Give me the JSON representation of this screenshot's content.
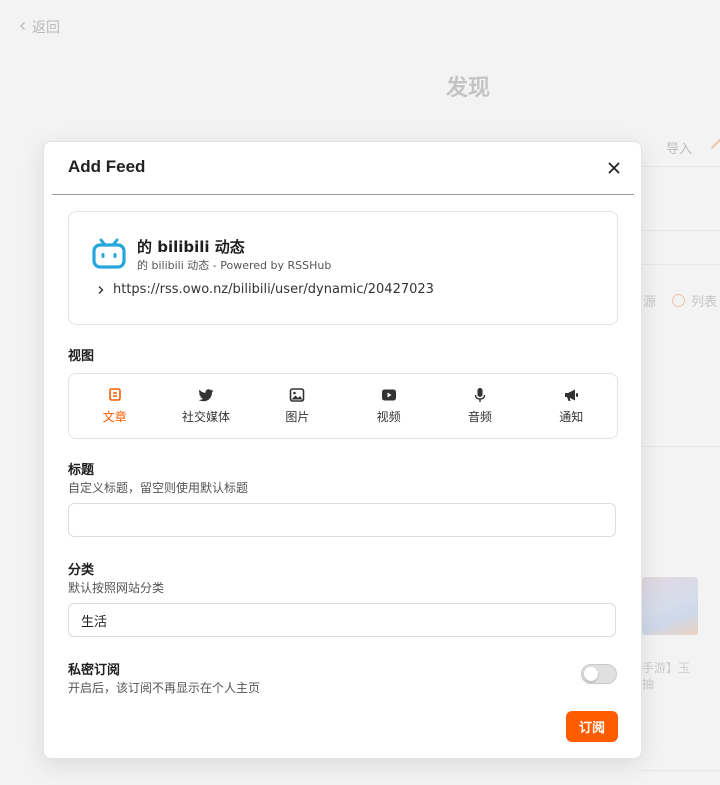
{
  "background": {
    "back_label": "返回",
    "page_title": "发现",
    "import_label": "导入",
    "source_label": "源",
    "list_label": "列表",
    "caption_line1": "手游】玉",
    "caption_line2": "抽"
  },
  "modal": {
    "title": "Add Feed",
    "close_icon": "close-icon",
    "feed": {
      "icon": "bilibili-logo",
      "brand_color": "#25a6dc",
      "name": "的 bilibili 动态",
      "description": "的 bilibili 动态 - Powered by RSSHub",
      "url": "https://rss.owo.nz/bilibili/user/dynamic/20427023"
    },
    "views_label": "视图",
    "views": [
      {
        "label": "文章",
        "icon": "article-icon",
        "active": true
      },
      {
        "label": "社交媒体",
        "icon": "twitter-bird-icon",
        "active": false
      },
      {
        "label": "图片",
        "icon": "image-icon",
        "active": false
      },
      {
        "label": "视频",
        "icon": "video-play-icon",
        "active": false
      },
      {
        "label": "音频",
        "icon": "microphone-icon",
        "active": false
      },
      {
        "label": "通知",
        "icon": "megaphone-icon",
        "active": false
      }
    ],
    "title_field": {
      "label": "标题",
      "hint": "自定义标题，留空则使用默认标题",
      "value": ""
    },
    "category_field": {
      "label": "分类",
      "hint": "默认按照网站分类",
      "value": "生活"
    },
    "private_field": {
      "label": "私密订阅",
      "hint": "开启后，该订阅不再显示在个人主页",
      "enabled": false
    },
    "subscribe_label": "订阅",
    "accent_color": "#ff5c00"
  }
}
